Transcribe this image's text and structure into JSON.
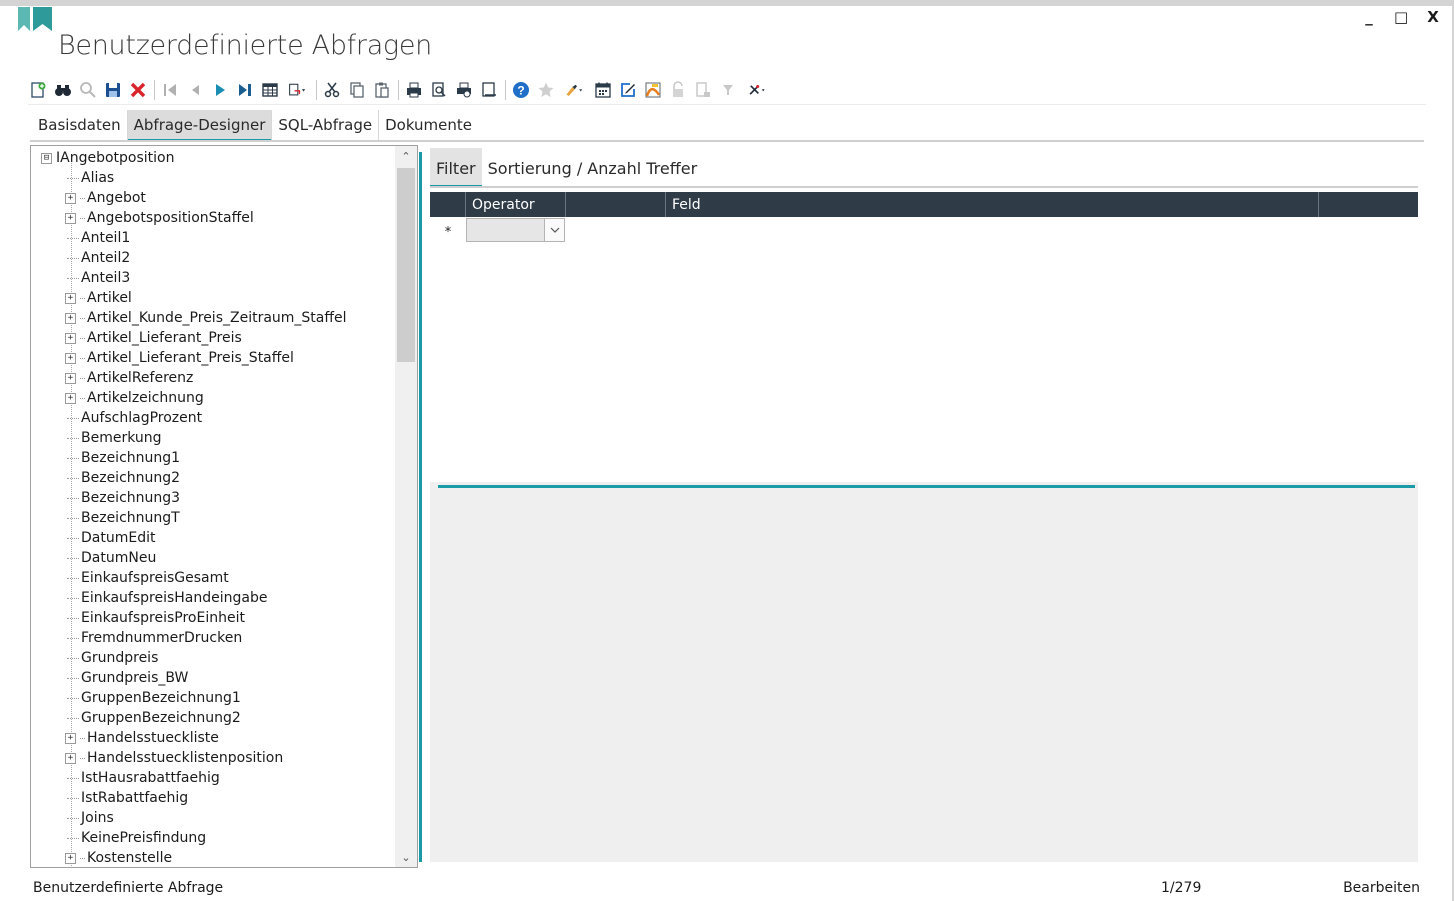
{
  "window": {
    "title": "Benutzerdefinierte Abfragen",
    "controls": {
      "minimize": "_",
      "maximize": "□",
      "close": "X"
    },
    "accent": "#1a9aa6"
  },
  "toolbar": {
    "icons": [
      "new-record-icon",
      "binoculars-icon",
      "magnifier-icon",
      "save-icon",
      "delete-icon",
      "first-record-icon",
      "previous-record-icon",
      "next-record-icon",
      "last-record-icon",
      "table-view-icon",
      "export-dropdown-icon",
      "cut-icon",
      "copy-icon",
      "paste-icon",
      "print-icon",
      "print-preview-icon",
      "print-setup-icon",
      "page-preview-icon",
      "help-icon",
      "favorite-icon",
      "edit-dropdown-icon",
      "calendar-icon",
      "edit-document-icon",
      "image-icon",
      "lock-icon",
      "document-lock-icon",
      "filter-icon",
      "tools-dropdown-icon"
    ]
  },
  "tabs": [
    {
      "label": "Basisdaten",
      "active": false
    },
    {
      "label": "Abfrage-Designer",
      "active": true
    },
    {
      "label": "SQL-Abfrage",
      "active": false
    },
    {
      "label": "Dokumente",
      "active": false
    }
  ],
  "tree": {
    "root": {
      "label": "IAngebotposition",
      "expander": "⊟"
    },
    "nodes": [
      {
        "label": "Alias",
        "expandable": false
      },
      {
        "label": "Angebot",
        "expandable": true
      },
      {
        "label": "AngebotspositionStaffel",
        "expandable": true
      },
      {
        "label": "Anteil1",
        "expandable": false
      },
      {
        "label": "Anteil2",
        "expandable": false
      },
      {
        "label": "Anteil3",
        "expandable": false
      },
      {
        "label": "Artikel",
        "expandable": true
      },
      {
        "label": "Artikel_Kunde_Preis_Zeitraum_Staffel",
        "expandable": true
      },
      {
        "label": "Artikel_Lieferant_Preis",
        "expandable": true
      },
      {
        "label": "Artikel_Lieferant_Preis_Staffel",
        "expandable": true
      },
      {
        "label": "ArtikelReferenz",
        "expandable": true
      },
      {
        "label": "Artikelzeichnung",
        "expandable": true
      },
      {
        "label": "AufschlagProzent",
        "expandable": false
      },
      {
        "label": "Bemerkung",
        "expandable": false
      },
      {
        "label": "Bezeichnung1",
        "expandable": false
      },
      {
        "label": "Bezeichnung2",
        "expandable": false
      },
      {
        "label": "Bezeichnung3",
        "expandable": false
      },
      {
        "label": "BezeichnungT",
        "expandable": false
      },
      {
        "label": "DatumEdit",
        "expandable": false
      },
      {
        "label": "DatumNeu",
        "expandable": false
      },
      {
        "label": "EinkaufspreisGesamt",
        "expandable": false
      },
      {
        "label": "EinkaufspreisHandeingabe",
        "expandable": false
      },
      {
        "label": "EinkaufspreisProEinheit",
        "expandable": false
      },
      {
        "label": "FremdnummerDrucken",
        "expandable": false
      },
      {
        "label": "Grundpreis",
        "expandable": false
      },
      {
        "label": "Grundpreis_BW",
        "expandable": false
      },
      {
        "label": "GruppenBezeichnung1",
        "expandable": false
      },
      {
        "label": "GruppenBezeichnung2",
        "expandable": false
      },
      {
        "label": "Handelsstueckliste",
        "expandable": true
      },
      {
        "label": "Handelsstuecklistenposition",
        "expandable": true
      },
      {
        "label": "IstHausrabattfaehig",
        "expandable": false
      },
      {
        "label": "IstRabattfaehig",
        "expandable": false
      },
      {
        "label": "Joins",
        "expandable": false
      },
      {
        "label": "KeinePreisfindung",
        "expandable": false
      },
      {
        "label": "Kostenstelle",
        "expandable": true
      }
    ],
    "scroll_up": "⌃",
    "scroll_down": "⌄"
  },
  "designer": {
    "tabs": [
      {
        "label": "Filter",
        "active": true
      },
      {
        "label": "Sortierung / Anzahl Treffer",
        "active": false
      }
    ],
    "grid": {
      "columns": [
        "",
        "Operator",
        "",
        "Feld",
        ""
      ],
      "new_row_marker": "*",
      "operator_value": ""
    }
  },
  "status": {
    "left": "Benutzerdefinierte Abfrage",
    "count": "1/279",
    "mode": "Bearbeiten"
  }
}
